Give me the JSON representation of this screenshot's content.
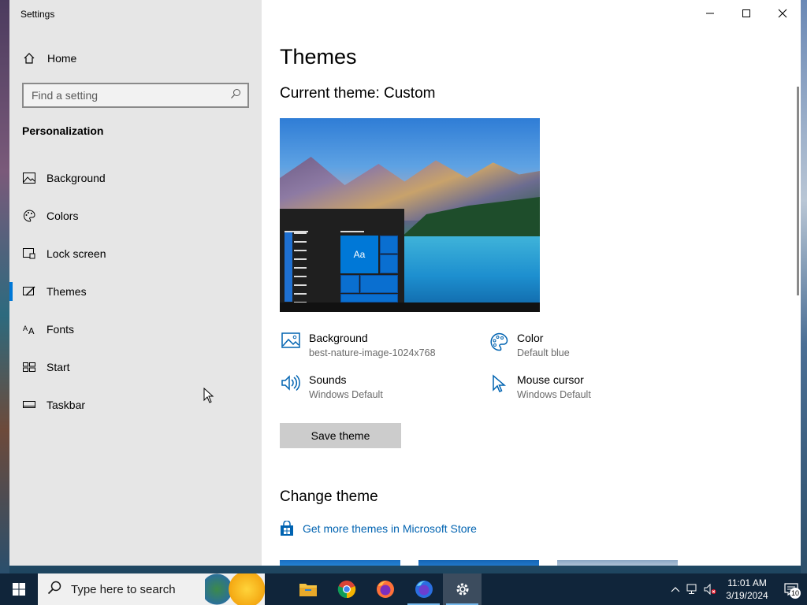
{
  "window": {
    "app_title": "Settings"
  },
  "sidebar": {
    "home_label": "Home",
    "search_placeholder": "Find a setting",
    "section_title": "Personalization",
    "items": [
      {
        "label": "Background",
        "icon": "image-icon"
      },
      {
        "label": "Colors",
        "icon": "palette-icon"
      },
      {
        "label": "Lock screen",
        "icon": "lock-screen-icon"
      },
      {
        "label": "Themes",
        "icon": "themes-icon",
        "active": true
      },
      {
        "label": "Fonts",
        "icon": "fonts-icon"
      },
      {
        "label": "Start",
        "icon": "start-icon"
      },
      {
        "label": "Taskbar",
        "icon": "taskbar-icon"
      }
    ]
  },
  "main": {
    "page_title": "Themes",
    "current_theme": "Current theme: Custom",
    "preview_tile_label": "Aa",
    "properties": {
      "background": {
        "label": "Background",
        "value": "best-nature-image-1024x768"
      },
      "color": {
        "label": "Color",
        "value": "Default blue"
      },
      "sounds": {
        "label": "Sounds",
        "value": "Windows Default"
      },
      "mouse_cursor": {
        "label": "Mouse cursor",
        "value": "Windows Default"
      }
    },
    "save_button": "Save theme",
    "change_theme_title": "Change theme",
    "store_link": "Get more themes in Microsoft Store"
  },
  "taskbar": {
    "search_placeholder": "Type here to search",
    "apps": [
      "file-explorer-icon",
      "chrome-icon",
      "firefox-icon",
      "firefox-dev-icon",
      "settings-icon"
    ],
    "clock_time": "11:01 AM",
    "clock_date": "3/19/2024",
    "notification_count": "10"
  },
  "colors": {
    "accent": "#0078d7",
    "link": "#0063b1",
    "sidebar_bg": "#e6e6e6",
    "taskbar_bg": "#10253a"
  }
}
